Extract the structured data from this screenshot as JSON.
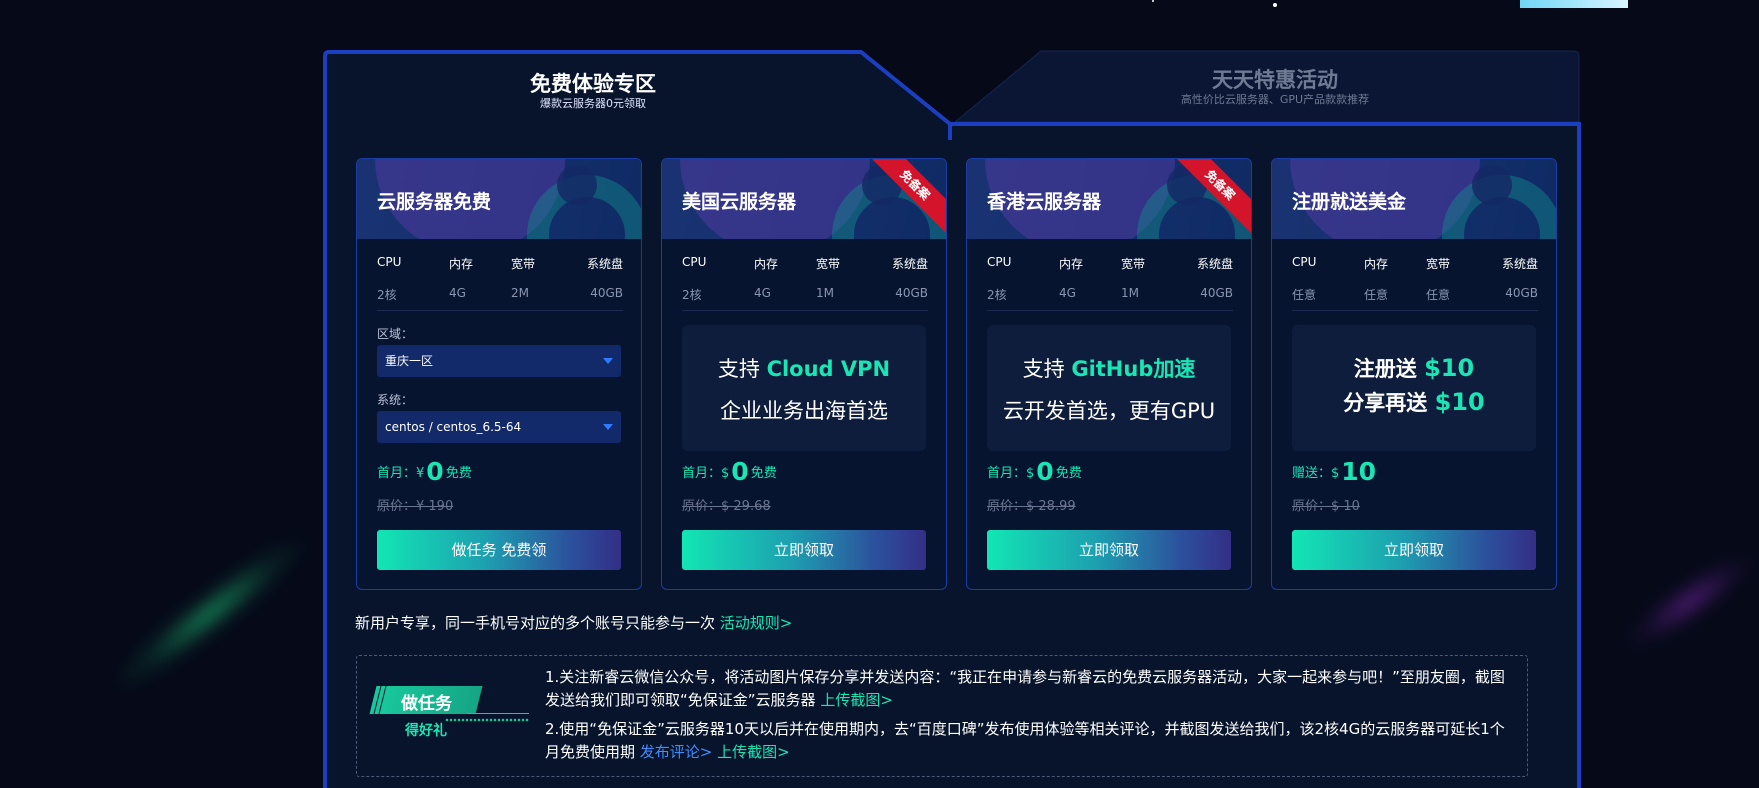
{
  "tabs": {
    "active": {
      "title": "免费体验专区",
      "subtitle": "爆款云服务器0元领取"
    },
    "inactive": {
      "title": "天天特惠活动",
      "subtitle": "高性价比云服务器、GPU产品款款推荐"
    }
  },
  "spec_headers": [
    "CPU",
    "内存",
    "宽带",
    "系统盘"
  ],
  "cards": [
    {
      "title": "云服务器免费",
      "ribbon": "",
      "specs": [
        "2核",
        "4G",
        "2M",
        "40GB"
      ],
      "region_label": "区域：",
      "region_value": "重庆一区",
      "system_label": "系统：",
      "system_value": "centos / centos_6.5-64",
      "price_prefix": "首月：¥",
      "price_value": "0",
      "price_suffix": "免费",
      "original": "原价：¥ 190",
      "button": "做任务 免费领"
    },
    {
      "title": "美国云服务器",
      "ribbon": "免备案",
      "specs": [
        "2核",
        "4G",
        "1M",
        "40GB"
      ],
      "promo_line1_prefix": "支持 ",
      "promo_line1_highlight": "Cloud VPN",
      "promo_line2": "企业业务出海首选",
      "price_prefix": "首月：$",
      "price_value": "0",
      "price_suffix": "免费",
      "original": "原价：$ 29.68",
      "button": "立即领取"
    },
    {
      "title": "香港云服务器",
      "ribbon": "免备案",
      "specs": [
        "2核",
        "4G",
        "1M",
        "40GB"
      ],
      "promo_line1_prefix": "支持 ",
      "promo_line1_highlight": "GitHub加速",
      "promo_line2": "云开发首选，更有GPU",
      "price_prefix": "首月：$",
      "price_value": "0",
      "price_suffix": "免费",
      "original": "原价：$ 28.99",
      "button": "立即领取"
    },
    {
      "title": "注册就送美金",
      "ribbon": "",
      "specs": [
        "任意",
        "任意",
        "任意",
        "40GB"
      ],
      "promo_line1_prefix": "注册送 ",
      "promo_line1_highlight": "$10",
      "promo_line2_prefix": "分享再送 ",
      "promo_line2_highlight": "$10",
      "price_prefix": "赠送：$",
      "price_value": "10",
      "price_suffix": "",
      "original": "原价：$ 10",
      "button": "立即领取"
    }
  ],
  "notice": {
    "text": "新用户专享，同一手机号对应的多个账号只能参与一次 ",
    "link": "活动规则>"
  },
  "task": {
    "badge": "做任务",
    "sub": "得好礼",
    "item1_text": "1.关注新睿云微信公众号，将活动图片保存分享并发送内容：“我正在申请参与新睿云的免费云服务器活动，大家一起来参与吧！”至朋友圈，截图发送给我们即可领取“免保证金”云服务器 ",
    "item1_link": "上传截图>",
    "item2_text": "2.使用“免保证金”云服务器10天以后并在使用期内，去“百度口碑”发布使用体验等相关评论，并截图发送给我们，该2核4G的云服务器可延长1个月免费使用期 ",
    "item2_link_blue": "发布评论>",
    "item2_link": "上传截图>"
  },
  "colors": {
    "accent": "#19e6b4",
    "border": "#1c3ec1",
    "ribbon": "#d4142b",
    "background": "#050918"
  }
}
